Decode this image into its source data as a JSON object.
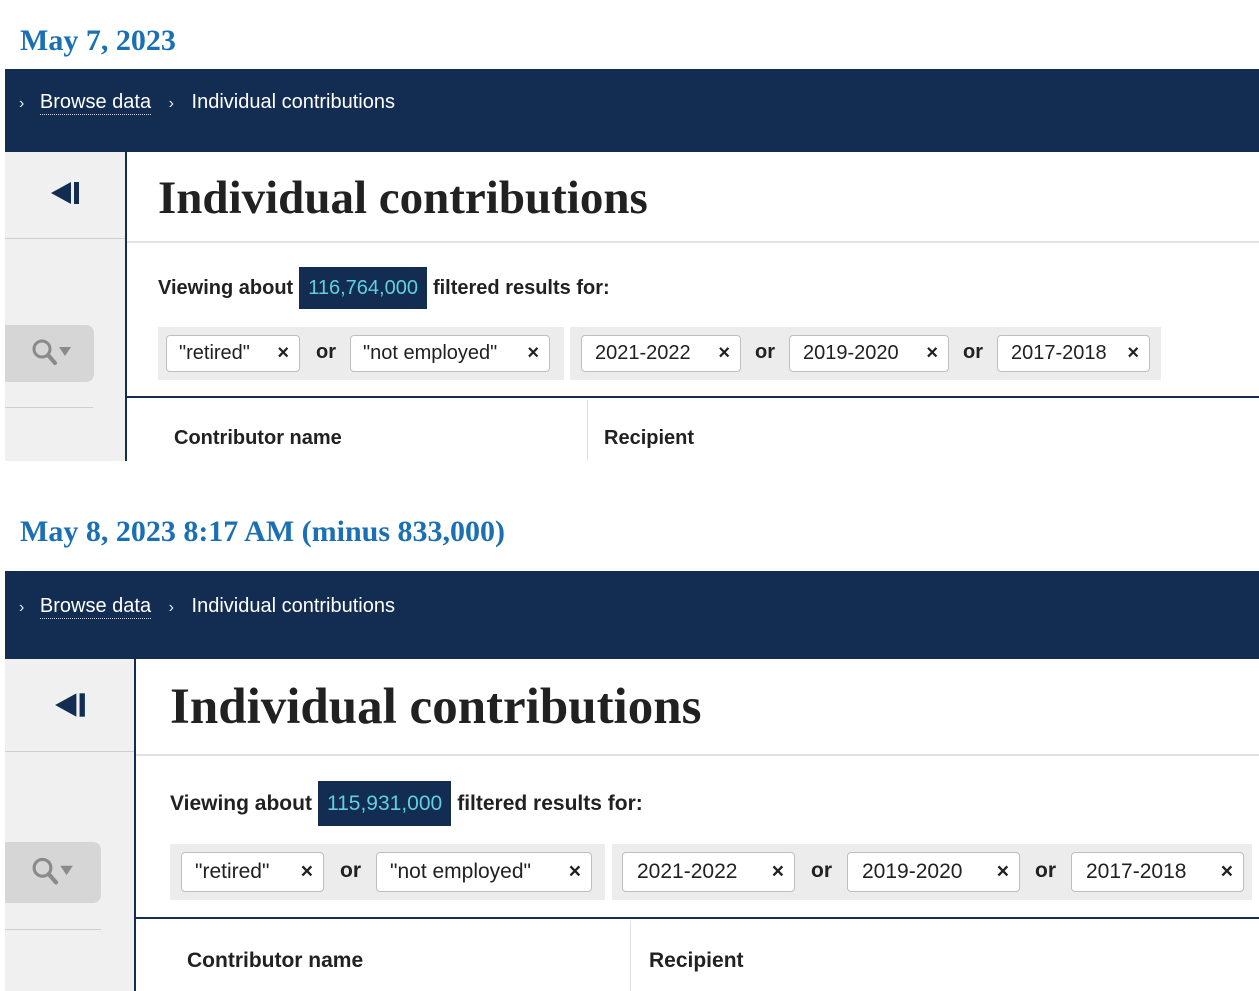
{
  "snapshots": [
    {
      "heading": "May 7, 2023",
      "breadcrumbs": {
        "link": "Browse data",
        "current": "Individual contributions"
      },
      "title": "Individual contributions",
      "viewing": {
        "prefix": "Viewing about",
        "count": "116,764,000",
        "suffix": "filtered results for:"
      },
      "employment_filters": [
        "\"retired\"",
        "\"not employed\""
      ],
      "period_filters": [
        "2021-2022",
        "2019-2020",
        "2017-2018"
      ],
      "connector": "or",
      "columns": [
        "Contributor name",
        "Recipient"
      ]
    },
    {
      "heading": "May 8, 2023 8:17 AM (minus 833,000)",
      "breadcrumbs": {
        "link": "Browse data",
        "current": "Individual contributions"
      },
      "title": "Individual contributions",
      "viewing": {
        "prefix": "Viewing about",
        "count": "115,931,000",
        "suffix": "filtered results for:"
      },
      "employment_filters": [
        "\"retired\"",
        "\"not employed\""
      ],
      "period_filters": [
        "2021-2022",
        "2019-2020",
        "2017-2018"
      ],
      "connector": "or",
      "columns": [
        "Contributor name",
        "Recipient"
      ]
    }
  ],
  "icons": {
    "breadcrumb_separator": "chevron-right-icon",
    "sidebar_toggle": "collapse-left-icon",
    "search": "search-filter-icon",
    "remove": "close-icon"
  },
  "remove_glyph": "×",
  "chevron_glyph": "›",
  "colors": {
    "nav_bar": "#122c52",
    "heading": "#1a6fb5",
    "count_text": "#5fd0df",
    "sidebar": "#f0f0f0"
  }
}
